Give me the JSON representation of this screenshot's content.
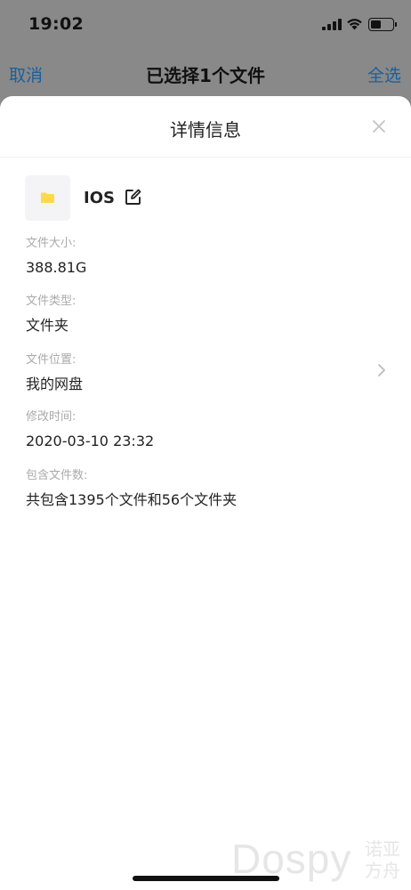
{
  "status_bar": {
    "time": "19:02"
  },
  "nav": {
    "cancel_label": "取消",
    "title": "已选择1个文件",
    "select_all_label": "全选",
    "accent_color": "#1a5f9c"
  },
  "sheet": {
    "title": "详情信息",
    "close_icon": "close-icon"
  },
  "file": {
    "name": "IOS",
    "icon": "folder-icon",
    "icon_color": "#ffd84d",
    "edit_icon": "edit-icon"
  },
  "fields": [
    {
      "label": "文件大小:",
      "value": "388.81G"
    },
    {
      "label": "文件类型:",
      "value": "文件夹"
    },
    {
      "label": "文件位置:",
      "value": "我的网盘"
    },
    {
      "label": "修改时间:",
      "value": "2020-03-10 23:32"
    },
    {
      "label": "包含文件数:",
      "value": "共包含1395个文件和56个文件夹"
    }
  ],
  "watermark": {
    "text": "Dospy",
    "cn_line1": "诺亚",
    "cn_line2": "方舟"
  }
}
